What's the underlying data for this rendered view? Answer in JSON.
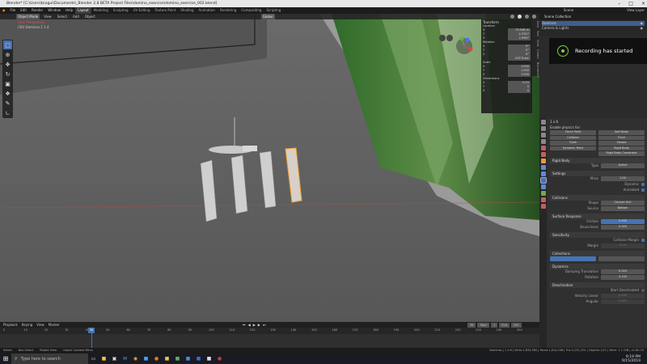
{
  "titlebar": {
    "title": "Blender* [C:\\Users\\brogui\\Documents\\_Blender 2.8 BETA Project Files\\domino_exercise\\domino_exercise_002.blend]"
  },
  "menubar": {
    "menus": [
      "File",
      "Edit",
      "Render",
      "Window",
      "Help"
    ],
    "workspaces": [
      "Layout",
      "Modeling",
      "Sculpting",
      "UV Editing",
      "Texture Paint",
      "Shading",
      "Animation",
      "Rendering",
      "Compositing",
      "Scripting"
    ],
    "active_workspace": "Layout",
    "scene_label": "Scene",
    "view_layer_label": "View Layer"
  },
  "viewport": {
    "mode": "Object Mode",
    "header_menus": [
      "View",
      "Select",
      "Add",
      "Object"
    ],
    "shading_label": "Global",
    "info_line1": "User Perspective",
    "info_line2": "(36) Dominos.1 1.4"
  },
  "n_panel": {
    "title": "Transform",
    "location_label": "Location",
    "location": [
      {
        "axis": "X",
        "value": "15.548 m"
      },
      {
        "axis": "Y",
        "value": "-1.9327"
      },
      {
        "axis": "Z",
        "value": "1.9907"
      }
    ],
    "rotation_label": "Rotation",
    "rotation": [
      {
        "axis": "X",
        "value": "0°"
      },
      {
        "axis": "Y",
        "value": "0°"
      },
      {
        "axis": "Z",
        "value": "0°"
      }
    ],
    "rot_mode": "XYZ Euler",
    "scale_label": "Scale",
    "scale": [
      {
        "axis": "X",
        "value": "1.000"
      },
      {
        "axis": "Y",
        "value": "1.000"
      },
      {
        "axis": "Z",
        "value": "1.000"
      }
    ],
    "dimensions_label": "Dimensions",
    "dimensions": [
      {
        "axis": "X",
        "value": "0.15"
      },
      {
        "axis": "Y",
        "value": "0"
      },
      {
        "axis": "Z",
        "value": "0"
      }
    ],
    "side_tabs": [
      "Item",
      "Tool",
      "View",
      "Create",
      "BlenderKit"
    ]
  },
  "recording": {
    "text": "Recording has started"
  },
  "outliner": {
    "header": "Scene Collection",
    "items": [
      {
        "label": "Dominos",
        "selected": true
      },
      {
        "label": "Camera & Lights",
        "selected": false
      }
    ]
  },
  "properties": {
    "object_name": "1 x 6",
    "enable_physics_label": "Enable physics for:",
    "physics_buttons": [
      "Force Field",
      "Soft Body",
      "Collision",
      "Fluid",
      "Cloth",
      "Smoke",
      "Dynamic Paint",
      "Rigid Body",
      "",
      "Rigid Body Constraint"
    ],
    "rigid_body_label": "Rigid Body",
    "type_label": "Type",
    "type_value": "Active",
    "settings_label": "Settings",
    "mass_label": "Mass",
    "mass_value": "1.00",
    "dynamic_label": "Dynamic",
    "animated_label": "Animated",
    "collisions_label": "Collisions",
    "shape_label": "Shape",
    "shape_value": "Convex Hull",
    "source_label": "Source",
    "source_value": "Bottom",
    "surface_label": "Surface Response",
    "friction_label": "Friction",
    "friction_value": "0.500",
    "bounciness_label": "Bounciness",
    "bounciness_value": "0.000",
    "sensitivity_label": "Sensitivity",
    "collision_margin_label": "Collision Margin",
    "margin_label": "Margin",
    "margin_value": "0.04",
    "collections_label": "Collections",
    "dynamics_label": "Dynamics",
    "damping_translation_label": "Damping Translation",
    "damping_translation_value": "0.040",
    "rotation_label": "Rotation",
    "rotation_value": "0.100",
    "deactivation_label": "Deactivation",
    "start_deactivated_label": "Start Deactivated",
    "velocity_linear_label": "Velocity Linear",
    "angular_label": "Angular",
    "velocity_linear_value": "0.400",
    "angular_value": "0.500"
  },
  "timeline": {
    "menus": [
      "Playback",
      "Keying",
      "View",
      "Marker"
    ],
    "current_frame": "36",
    "start_label": "Start",
    "start_value": "1",
    "end_label": "End",
    "end_value": "250",
    "ticks": [
      "0",
      "10",
      "20",
      "30",
      "40",
      "50",
      "60",
      "70",
      "80",
      "90",
      "100",
      "110",
      "120",
      "130",
      "140",
      "150",
      "160",
      "170",
      "180",
      "190",
      "200",
      "210",
      "220",
      "230",
      "240",
      "250"
    ]
  },
  "statusbar": {
    "select": "Select",
    "box_select": "Box Select",
    "rotate_view": "Rotate View",
    "context_menu": "Object Context Menu",
    "stats": "Dominos | 1 x 6 | Verts:1,634,360 | Faces:1,614,048 | Tris:3,231,224 | Objects:1/21 | Mem: 1.1 GiB | v2.80.70"
  },
  "taskbar": {
    "search_placeholder": "Type here to search",
    "apps": [
      "task-view",
      "file-explorer",
      "store",
      "mail",
      "chrome",
      "photoshop",
      "blender",
      "explorer2",
      "notepad",
      "vscode",
      "word",
      "terminal",
      "misc"
    ],
    "time": "9:19 PM",
    "date": "9/15/2019"
  }
}
